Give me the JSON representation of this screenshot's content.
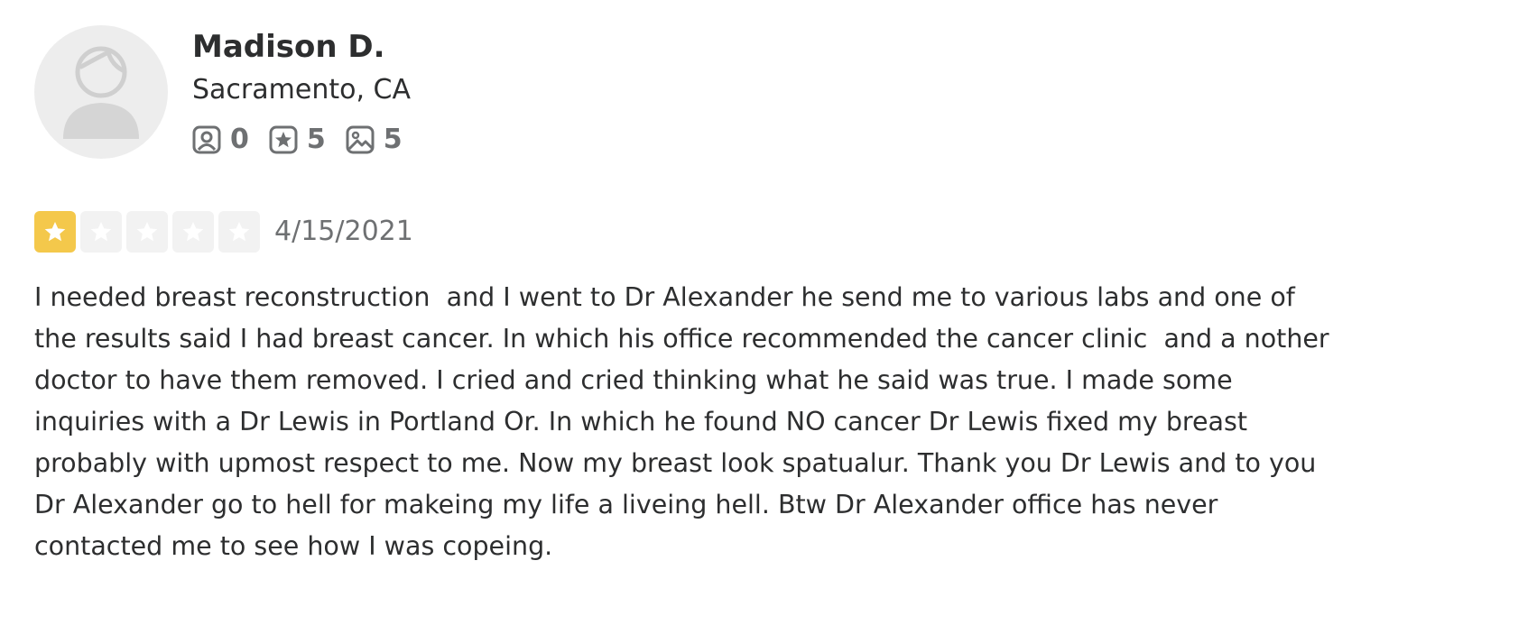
{
  "user": {
    "name": "Madison D.",
    "location": "Sacramento, CA",
    "stats": [
      {
        "icon": "friends-icon",
        "value": "0"
      },
      {
        "icon": "reviews-star-icon",
        "value": "5"
      },
      {
        "icon": "photos-icon",
        "value": "5"
      }
    ]
  },
  "review": {
    "rating": 1,
    "rating_max": 5,
    "rating_color": "#f4c84b",
    "date": "4/15/2021",
    "lines": [
      "I needed breast reconstruction  and I went to Dr Alexander he send me to various labs and one of",
      "the results said I had breast cancer. In which his office recommended the cancer clinic  and a nother",
      "doctor to have them removed. I cried and cried thinking what he said was true. I made some",
      "inquiries with a Dr Lewis in Portland Or. In which he found NO cancer Dr Lewis fixed my breast",
      "probably with upmost respect to me. Now my breast look spatualur. Thank you Dr Lewis and to you",
      "Dr Alexander go to hell for makeing my life a liveing hell. Btw Dr Alexander office has never",
      "contacted me to see how I was copeing."
    ]
  }
}
